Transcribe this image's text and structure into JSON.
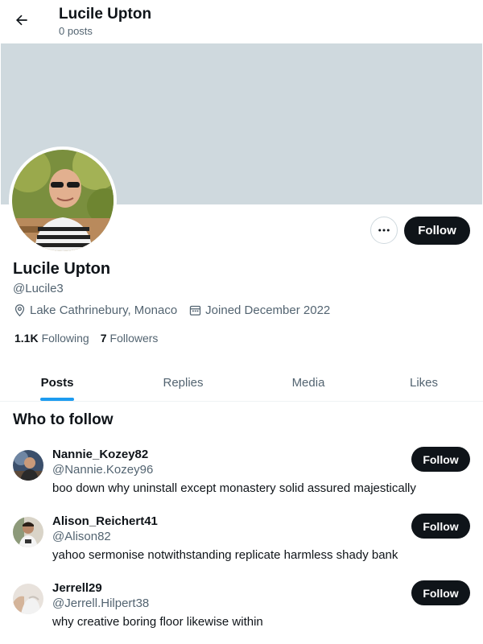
{
  "header": {
    "title": "Lucile Upton",
    "subtitle": "0 posts",
    "back_icon": "arrow-left-icon"
  },
  "profile": {
    "display_name": "Lucile Upton",
    "handle": "@Lucile3",
    "location": "Lake Cathrinebury, Monaco",
    "joined": "Joined December 2022",
    "following_count": "1.1K",
    "following_label": "Following",
    "followers_count": "7",
    "followers_label": "Followers",
    "follow_label": "Follow",
    "more_icon": "more-dots-icon"
  },
  "colors": {
    "banner": "#cfd9de",
    "accent": "#1d9bf0",
    "button": "#0f1419",
    "secondary_text": "#536471"
  },
  "tabs": [
    {
      "label": "Posts",
      "active": true
    },
    {
      "label": "Replies",
      "active": false
    },
    {
      "label": "Media",
      "active": false
    },
    {
      "label": "Likes",
      "active": false
    }
  ],
  "who_to_follow": {
    "title": "Who to follow",
    "users": [
      {
        "name": "Nannie_Kozey82",
        "handle": "@Nannie.Kozey96",
        "bio": "boo down why uninstall except monastery solid assured majestically",
        "follow_label": "Follow"
      },
      {
        "name": "Alison_Reichert41",
        "handle": "@Alison82",
        "bio": "yahoo sermonise notwithstanding replicate harmless shady bank",
        "follow_label": "Follow"
      },
      {
        "name": "Jerrell29",
        "handle": "@Jerrell.Hilpert38",
        "bio": "why creative boring floor likewise within",
        "follow_label": "Follow"
      }
    ]
  }
}
